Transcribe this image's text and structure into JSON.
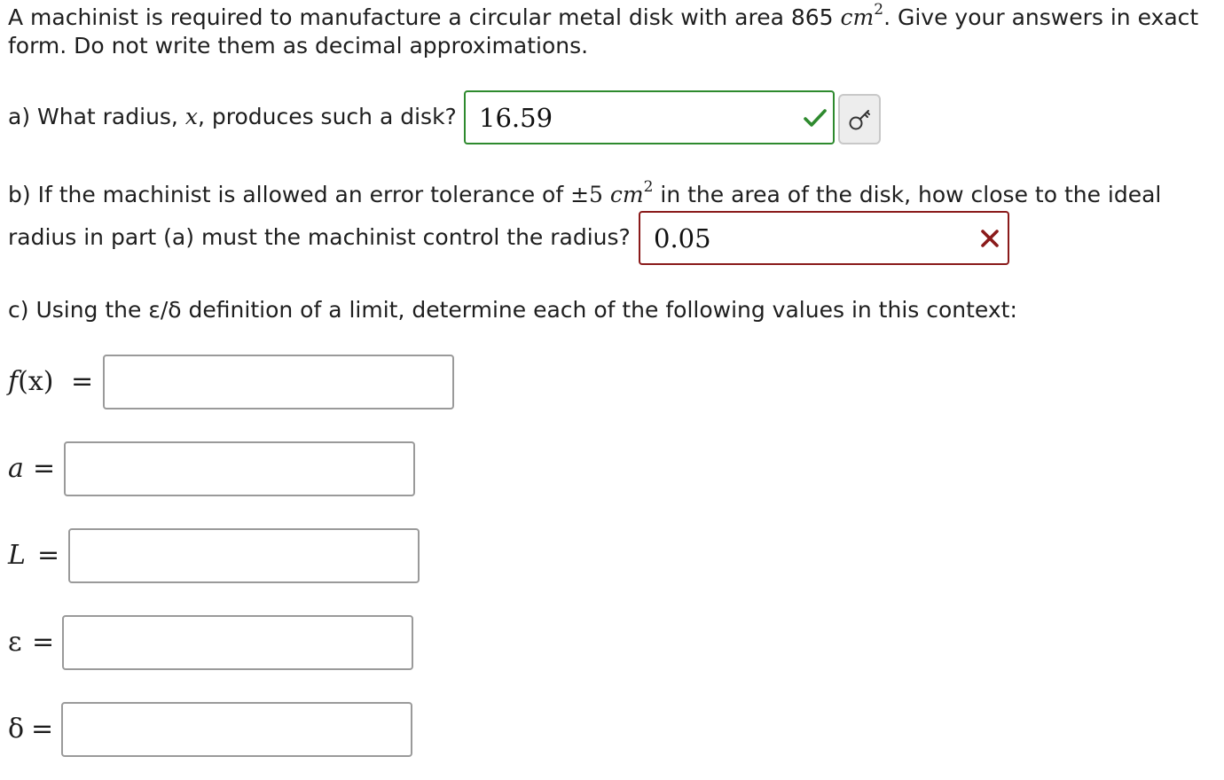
{
  "problem": {
    "intro_part1": "A machinist is required to manufacture a circular metal disk with area 865 ",
    "unit": "cm",
    "unit_exponent": "2",
    "intro_part2": ". Give your answers in exact",
    "intro_line2": "form. Do not write them as decimal approximations."
  },
  "part_a": {
    "question_before": "a) What radius, ",
    "variable": "x",
    "question_after": ", produces such a disk?",
    "answer": "16.59",
    "status": "correct"
  },
  "part_b": {
    "line1_before": "b) If the machinist is allowed an error tolerance of ",
    "tolerance": "±5 ",
    "unit": "cm",
    "unit_exponent": "2",
    "line1_after": " in the area of the disk, how close to the ideal",
    "line2": "radius in part (a) must the machinist control the radius?",
    "answer": "0.05",
    "status": "incorrect"
  },
  "part_c": {
    "prompt": "c) Using the ε/δ definition of a limit, determine each of the following values in this context:",
    "fields": [
      {
        "label_var": "f",
        "label_rest": "(x)",
        "equals": "=",
        "value": ""
      },
      {
        "label_var": "a",
        "label_rest": "",
        "equals": "=",
        "value": ""
      },
      {
        "label_var": "L",
        "label_rest": "",
        "equals": "=",
        "value": ""
      },
      {
        "label_var": "ε",
        "label_rest": "",
        "equals": "=",
        "value": ""
      },
      {
        "label_var": "δ",
        "label_rest": "",
        "equals": "=",
        "value": ""
      }
    ]
  },
  "colors": {
    "correct": "#2e8a2e",
    "incorrect": "#8a1a1a",
    "text": "#1e1e1e"
  },
  "icons": {
    "correct_mark": "checkmark-icon",
    "incorrect_mark": "x-mark-icon",
    "answer_key": "key-icon"
  }
}
